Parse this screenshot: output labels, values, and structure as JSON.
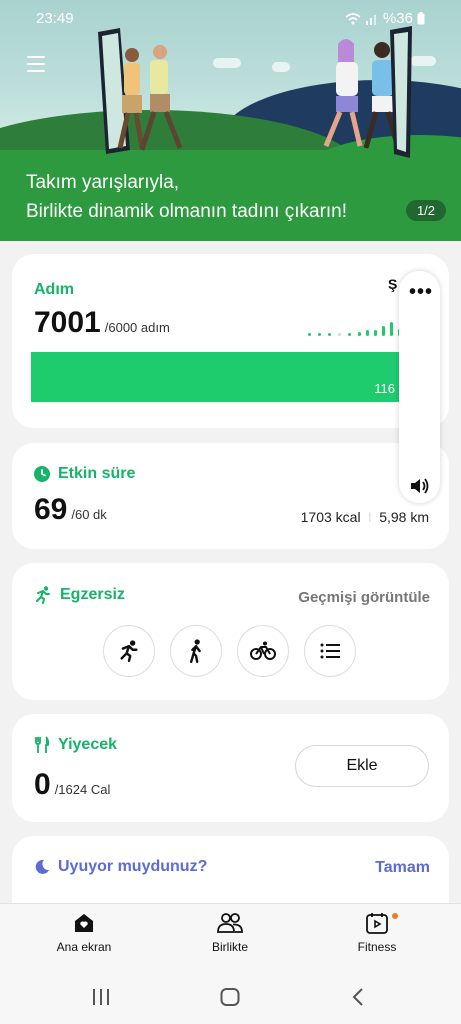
{
  "status_bar": {
    "time": "23:49",
    "battery": "%36"
  },
  "banner": {
    "line1": "Takım yarışlarıyla,",
    "line2": "Birlikte dinamik olmanın tadını çıkarın!",
    "page_indicator": "1/2"
  },
  "steps": {
    "title": "Adım",
    "value": "7001",
    "goal": "/6000 adım",
    "bar_value": "116",
    "top_right_label": "Ş",
    "progress_fraction": 1.0
  },
  "active": {
    "title": "Etkin süre",
    "value": "69",
    "goal": "/60 dk",
    "kcal": "1703 kcal",
    "distance": "5,98 km"
  },
  "exercise": {
    "title": "Egzersiz",
    "history_link": "Geçmişi görüntüle",
    "buttons": [
      "running-icon",
      "walking-icon",
      "cycling-icon",
      "list-icon"
    ]
  },
  "food": {
    "title": "Yiyecek",
    "value": "0",
    "goal": "/1624 Cal",
    "add_label": "Ekle"
  },
  "sleep": {
    "title": "Uyuyor muydunuz?",
    "action": "Tamam"
  },
  "bottom_nav": {
    "home": "Ana ekran",
    "together": "Birlikte",
    "fitness": "Fitness"
  },
  "colors": {
    "accent_green": "#16b368",
    "bar_green": "#1ecb6d",
    "sleep_blue": "#5c6bd6",
    "notification_dot": "#f07b2b"
  }
}
